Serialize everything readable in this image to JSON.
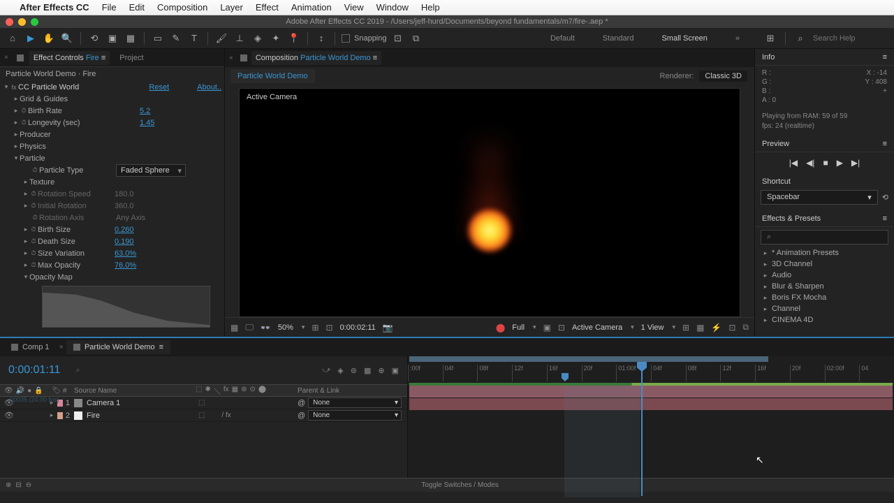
{
  "menubar": {
    "app": "After Effects CC",
    "items": [
      "File",
      "Edit",
      "Composition",
      "Layer",
      "Effect",
      "Animation",
      "View",
      "Window",
      "Help"
    ]
  },
  "window_title": "Adobe After Effects CC 2019 - /Users/jeff-hurd/Documents/beyond fundamentals/m7/fire-.aep *",
  "toolbar": {
    "snapping": "Snapping",
    "workspaces": [
      "Default",
      "Standard",
      "Small Screen"
    ],
    "active_ws": "Small Screen",
    "search_ph": "Search Help"
  },
  "effect_panel": {
    "tab_active": "Effect Controls",
    "tab_active_layer": "Fire",
    "tab2": "Project",
    "sub": "Particle World Demo · Fire",
    "fx_name": "CC Particle World",
    "reset": "Reset",
    "about": "About..",
    "rows": {
      "grid": "Grid & Guides",
      "birth_rate": {
        "l": "Birth Rate",
        "v": "5.2"
      },
      "longevity": {
        "l": "Longevity (sec)",
        "v": "1.45"
      },
      "producer": "Producer",
      "physics": "Physics",
      "particle": "Particle",
      "ptype": {
        "l": "Particle Type",
        "v": "Faded Sphere"
      },
      "texture": "Texture",
      "rspeed": {
        "l": "Rotation Speed",
        "v": "180.0"
      },
      "irot": {
        "l": "Initial Rotation",
        "v": "360.0"
      },
      "raxis": {
        "l": "Rotation Axis",
        "v": "Any Axis"
      },
      "bsize": {
        "l": "Birth Size",
        "v": "0.260"
      },
      "dsize": {
        "l": "Death Size",
        "v": "0.190"
      },
      "svar": {
        "l": "Size Variation",
        "v": "63.0%"
      },
      "mopac": {
        "l": "Max Opacity",
        "v": "76.0%"
      },
      "omap": "Opacity Map"
    }
  },
  "comp_panel": {
    "tab": "Composition",
    "tab_name": "Particle World Demo",
    "crumb": "Particle World Demo",
    "renderer_l": "Renderer:",
    "renderer_v": "Classic 3D",
    "camera": "Active Camera",
    "bar": {
      "zoom": "50%",
      "tc": "0:00:02:11",
      "res": "Full",
      "cam": "Active Camera",
      "views": "1 View"
    }
  },
  "info": {
    "title": "Info",
    "R": "R :",
    "G": "G :",
    "B": "B :",
    "A": "A :  0",
    "X": "X :   -14",
    "Y": "Y :   408",
    "playmsg1": "Playing from RAM: 59 of 59",
    "playmsg2": "fps: 24 (realtime)"
  },
  "preview": {
    "title": "Preview"
  },
  "shortcut": {
    "title": "Shortcut",
    "val": "Spacebar"
  },
  "fxpresets": {
    "title": "Effects & Presets",
    "items": [
      "* Animation Presets",
      "3D Channel",
      "Audio",
      "Blur & Sharpen",
      "Boris FX Mocha",
      "Channel",
      "CINEMA 4D"
    ]
  },
  "timeline": {
    "tab1": "Comp 1",
    "tab2": "Particle World Demo",
    "tc": "0:00:01:11",
    "frames": "00035 (24.00 fps)",
    "col_num": "#",
    "col_name": "Source Name",
    "col_parent": "Parent & Link",
    "layers": [
      {
        "num": "1",
        "name": "Camera 1",
        "parent": "None",
        "color": "pink",
        "ico": "cam"
      },
      {
        "num": "2",
        "name": "Fire",
        "parent": "None",
        "color": "peach",
        "ico": "solid"
      }
    ],
    "ticks": [
      ":00f",
      "04f",
      "08f",
      "12f",
      "16f",
      "20f",
      "01:00f",
      "04f",
      "08f",
      "12f",
      "16f",
      "20f",
      "02:00f",
      "04"
    ],
    "footer": "Toggle Switches / Modes"
  }
}
